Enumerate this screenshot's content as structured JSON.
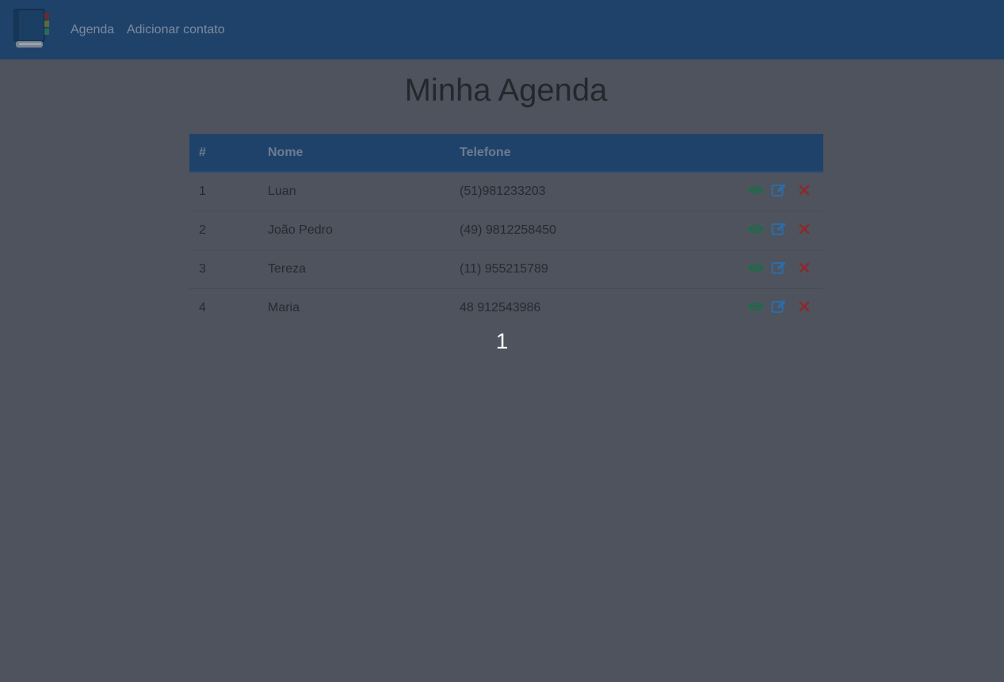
{
  "nav": {
    "brand_icon": "address-book-icon",
    "links": [
      "Agenda",
      "Adicionar contato"
    ]
  },
  "page": {
    "title": "Minha Agenda"
  },
  "table": {
    "headers": [
      "#",
      "Nome",
      "Telefone",
      ""
    ],
    "rows": [
      {
        "num": "1",
        "nome": "Luan",
        "telefone": "(51)981233203"
      },
      {
        "num": "2",
        "nome": "João Pedro",
        "telefone": "(49) 9812258450"
      },
      {
        "num": "3",
        "nome": "Tereza",
        "telefone": "(11) 955215789"
      },
      {
        "num": "4",
        "nome": "Maria",
        "telefone": "48 912543986"
      }
    ],
    "row_actions": [
      "eye-icon",
      "edit-icon",
      "delete-icon"
    ]
  },
  "pagination": {
    "current": "1"
  },
  "colors": {
    "navbar": "#1f426b",
    "background": "#4f535d",
    "view": "#1e6a4a",
    "edit": "#2b6ca8",
    "delete": "#8a2a2c"
  }
}
